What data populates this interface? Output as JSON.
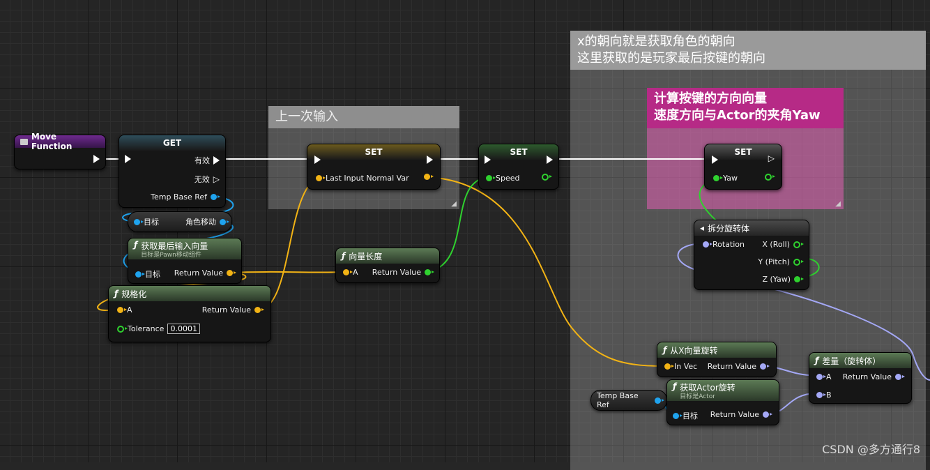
{
  "comments": {
    "big": "x的朝向就是获取角色的朝向\n这里获取的是玩家最后按键的朝向",
    "last_input": "上一次输入",
    "calc": "计算按键的方向向量\n速度方向与Actor的夹角Yaw"
  },
  "nodes": {
    "move_function": {
      "title": "Move Function"
    },
    "get": {
      "title": "GET",
      "valid": "有效",
      "invalid": "无效",
      "temp_base_ref": "Temp Base Ref"
    },
    "get_target": {
      "target": "目标",
      "move_comp": "角色移动"
    },
    "get_last_input": {
      "title": "获取最后输入向量",
      "subtitle": "目标是Pawn移动组件",
      "target": "目标",
      "return_value": "Return Value"
    },
    "normalize": {
      "title": "规格化",
      "a": "A",
      "return_value": "Return Value",
      "tolerance": "Tolerance",
      "tolerance_value": "0.0001"
    },
    "set_last_input": {
      "title": "SET",
      "var": "Last Input Normal Var"
    },
    "vector_length": {
      "title": "向量长度",
      "a": "A",
      "return_value": "Return Value"
    },
    "set_speed": {
      "title": "SET",
      "var": "Speed"
    },
    "set_yaw": {
      "title": "SET",
      "var": "Yaw"
    },
    "break_rotator": {
      "title": "拆分旋转体",
      "rotation": "Rotation",
      "x": "X (Roll)",
      "y": "Y (Pitch)",
      "z": "Z (Yaw)"
    },
    "rot_from_x": {
      "title": "从X向量旋转",
      "in_vec": "In Vec",
      "return_value": "Return Value"
    },
    "get_actor_rot": {
      "title": "获取Actor旋转",
      "subtitle": "目标是Actor",
      "target": "目标",
      "return_value": "Return Value"
    },
    "delta_rot": {
      "title": "差量（旋转体）",
      "a": "A",
      "b": "B",
      "return_value": "Return Value"
    },
    "temp_base_ref_pill": {
      "label": "Temp Base Ref"
    }
  },
  "watermark": "CSDN @多方通行8",
  "colors": {
    "float": "#2fd12f",
    "vector": "#f2b315",
    "object": "#1fa3ee",
    "rotator": "#a4a8f6",
    "exec": "#ffffff",
    "comment_pink": "#b62a86"
  }
}
